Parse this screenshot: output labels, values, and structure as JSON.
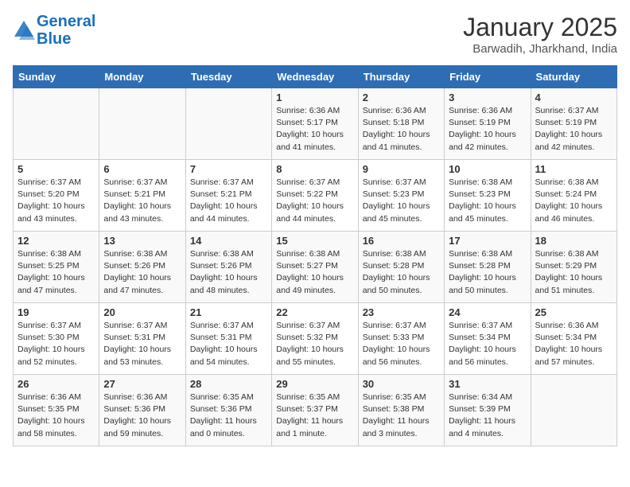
{
  "header": {
    "logo_line1": "General",
    "logo_line2": "Blue",
    "month": "January 2025",
    "location": "Barwadih, Jharkhand, India"
  },
  "days_of_week": [
    "Sunday",
    "Monday",
    "Tuesday",
    "Wednesday",
    "Thursday",
    "Friday",
    "Saturday"
  ],
  "weeks": [
    [
      {
        "day": "",
        "content": ""
      },
      {
        "day": "",
        "content": ""
      },
      {
        "day": "",
        "content": ""
      },
      {
        "day": "1",
        "content": "Sunrise: 6:36 AM\nSunset: 5:17 PM\nDaylight: 10 hours\nand 41 minutes."
      },
      {
        "day": "2",
        "content": "Sunrise: 6:36 AM\nSunset: 5:18 PM\nDaylight: 10 hours\nand 41 minutes."
      },
      {
        "day": "3",
        "content": "Sunrise: 6:36 AM\nSunset: 5:19 PM\nDaylight: 10 hours\nand 42 minutes."
      },
      {
        "day": "4",
        "content": "Sunrise: 6:37 AM\nSunset: 5:19 PM\nDaylight: 10 hours\nand 42 minutes."
      }
    ],
    [
      {
        "day": "5",
        "content": "Sunrise: 6:37 AM\nSunset: 5:20 PM\nDaylight: 10 hours\nand 43 minutes."
      },
      {
        "day": "6",
        "content": "Sunrise: 6:37 AM\nSunset: 5:21 PM\nDaylight: 10 hours\nand 43 minutes."
      },
      {
        "day": "7",
        "content": "Sunrise: 6:37 AM\nSunset: 5:21 PM\nDaylight: 10 hours\nand 44 minutes."
      },
      {
        "day": "8",
        "content": "Sunrise: 6:37 AM\nSunset: 5:22 PM\nDaylight: 10 hours\nand 44 minutes."
      },
      {
        "day": "9",
        "content": "Sunrise: 6:37 AM\nSunset: 5:23 PM\nDaylight: 10 hours\nand 45 minutes."
      },
      {
        "day": "10",
        "content": "Sunrise: 6:38 AM\nSunset: 5:23 PM\nDaylight: 10 hours\nand 45 minutes."
      },
      {
        "day": "11",
        "content": "Sunrise: 6:38 AM\nSunset: 5:24 PM\nDaylight: 10 hours\nand 46 minutes."
      }
    ],
    [
      {
        "day": "12",
        "content": "Sunrise: 6:38 AM\nSunset: 5:25 PM\nDaylight: 10 hours\nand 47 minutes."
      },
      {
        "day": "13",
        "content": "Sunrise: 6:38 AM\nSunset: 5:26 PM\nDaylight: 10 hours\nand 47 minutes."
      },
      {
        "day": "14",
        "content": "Sunrise: 6:38 AM\nSunset: 5:26 PM\nDaylight: 10 hours\nand 48 minutes."
      },
      {
        "day": "15",
        "content": "Sunrise: 6:38 AM\nSunset: 5:27 PM\nDaylight: 10 hours\nand 49 minutes."
      },
      {
        "day": "16",
        "content": "Sunrise: 6:38 AM\nSunset: 5:28 PM\nDaylight: 10 hours\nand 50 minutes."
      },
      {
        "day": "17",
        "content": "Sunrise: 6:38 AM\nSunset: 5:28 PM\nDaylight: 10 hours\nand 50 minutes."
      },
      {
        "day": "18",
        "content": "Sunrise: 6:38 AM\nSunset: 5:29 PM\nDaylight: 10 hours\nand 51 minutes."
      }
    ],
    [
      {
        "day": "19",
        "content": "Sunrise: 6:37 AM\nSunset: 5:30 PM\nDaylight: 10 hours\nand 52 minutes."
      },
      {
        "day": "20",
        "content": "Sunrise: 6:37 AM\nSunset: 5:31 PM\nDaylight: 10 hours\nand 53 minutes."
      },
      {
        "day": "21",
        "content": "Sunrise: 6:37 AM\nSunset: 5:31 PM\nDaylight: 10 hours\nand 54 minutes."
      },
      {
        "day": "22",
        "content": "Sunrise: 6:37 AM\nSunset: 5:32 PM\nDaylight: 10 hours\nand 55 minutes."
      },
      {
        "day": "23",
        "content": "Sunrise: 6:37 AM\nSunset: 5:33 PM\nDaylight: 10 hours\nand 56 minutes."
      },
      {
        "day": "24",
        "content": "Sunrise: 6:37 AM\nSunset: 5:34 PM\nDaylight: 10 hours\nand 56 minutes."
      },
      {
        "day": "25",
        "content": "Sunrise: 6:36 AM\nSunset: 5:34 PM\nDaylight: 10 hours\nand 57 minutes."
      }
    ],
    [
      {
        "day": "26",
        "content": "Sunrise: 6:36 AM\nSunset: 5:35 PM\nDaylight: 10 hours\nand 58 minutes."
      },
      {
        "day": "27",
        "content": "Sunrise: 6:36 AM\nSunset: 5:36 PM\nDaylight: 10 hours\nand 59 minutes."
      },
      {
        "day": "28",
        "content": "Sunrise: 6:35 AM\nSunset: 5:36 PM\nDaylight: 11 hours\nand 0 minutes."
      },
      {
        "day": "29",
        "content": "Sunrise: 6:35 AM\nSunset: 5:37 PM\nDaylight: 11 hours\nand 1 minute."
      },
      {
        "day": "30",
        "content": "Sunrise: 6:35 AM\nSunset: 5:38 PM\nDaylight: 11 hours\nand 3 minutes."
      },
      {
        "day": "31",
        "content": "Sunrise: 6:34 AM\nSunset: 5:39 PM\nDaylight: 11 hours\nand 4 minutes."
      },
      {
        "day": "",
        "content": ""
      }
    ]
  ]
}
